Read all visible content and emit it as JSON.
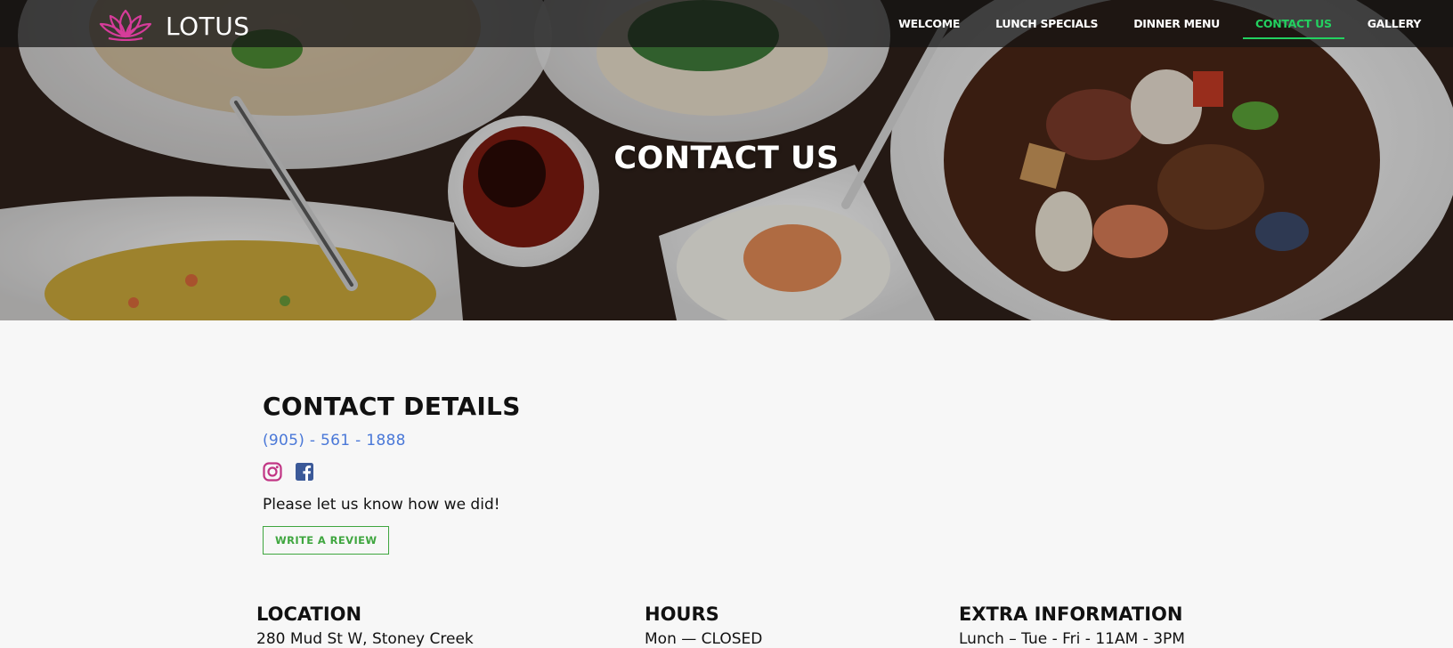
{
  "brand": {
    "name": "LOTUS",
    "logo_icon": "lotus-flower-icon",
    "logo_color": "#d63c9a"
  },
  "nav": {
    "items": [
      {
        "label": "WELCOME"
      },
      {
        "label": "LUNCH SPECIALS"
      },
      {
        "label": "DINNER MENU"
      },
      {
        "label": "CONTACT US",
        "active": true
      },
      {
        "label": "GALLERY"
      }
    ],
    "active_color": "#23d160"
  },
  "hero": {
    "title": "CONTACT US"
  },
  "contact": {
    "heading": "CONTACT DETAILS",
    "phone": "(905) - 561 - 1888",
    "social": [
      {
        "icon": "instagram-icon",
        "color": "#c13584"
      },
      {
        "icon": "facebook-icon",
        "color": "#3b5998"
      }
    ],
    "review_prompt": "Please let us know how we did!",
    "review_button": "WRITE A REVIEW"
  },
  "sections": {
    "location": {
      "heading": "LOCATION",
      "line": "280 Mud St W, Stoney Creek"
    },
    "hours": {
      "heading": "HOURS",
      "line": "Mon — CLOSED"
    },
    "extra": {
      "heading": "EXTRA INFORMATION",
      "line": "Lunch – Tue - Fri - 11AM - 3PM"
    }
  }
}
